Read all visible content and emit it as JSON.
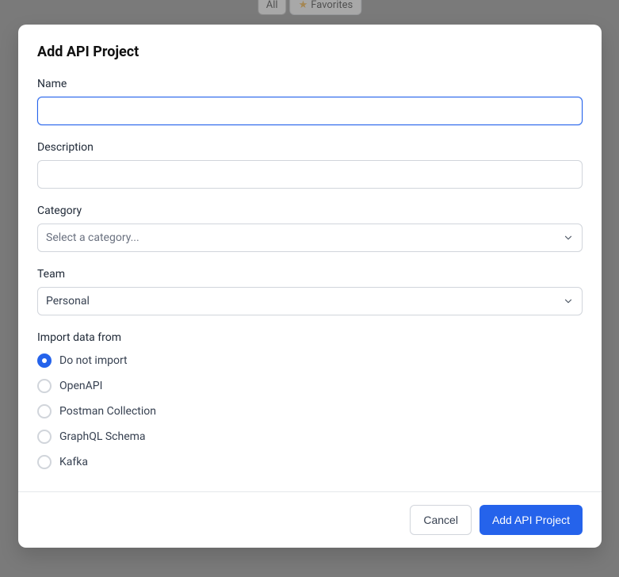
{
  "background": {
    "pill_all": "All",
    "pill_favorites": "Favorites"
  },
  "modal": {
    "title": "Add API Project",
    "fields": {
      "name": {
        "label": "Name",
        "value": ""
      },
      "description": {
        "label": "Description",
        "value": ""
      },
      "category": {
        "label": "Category",
        "placeholder": "Select a category..."
      },
      "team": {
        "label": "Team",
        "value": "Personal"
      },
      "import": {
        "label": "Import data from",
        "options": [
          {
            "label": "Do not import",
            "selected": true
          },
          {
            "label": "OpenAPI",
            "selected": false
          },
          {
            "label": "Postman Collection",
            "selected": false
          },
          {
            "label": "GraphQL Schema",
            "selected": false
          },
          {
            "label": "Kafka",
            "selected": false
          }
        ]
      }
    },
    "footer": {
      "cancel": "Cancel",
      "submit": "Add API Project"
    }
  }
}
